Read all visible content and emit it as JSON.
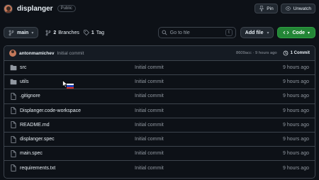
{
  "repo": {
    "name": "displanger",
    "visibility": "Public",
    "pin_label": "Pin",
    "unwatch_label": "Unwatch",
    "unwatch_count": "1"
  },
  "toolbar": {
    "branch": "main",
    "branches_count": "2",
    "branches_label": "Branches",
    "tags_count": "1",
    "tags_label": "Tag",
    "search_placeholder": "Go to file",
    "search_shortcut": "t",
    "add_file_label": "Add file",
    "code_label": "Code"
  },
  "latest_commit": {
    "author": "antonmamichev",
    "message": "Initial commit",
    "hash_time": "8609acc · 9 hours ago",
    "commits_label": "1 Commit"
  },
  "files": [
    {
      "name": "src",
      "type": "folder",
      "commit": "Initial commit",
      "date": "9 hours ago"
    },
    {
      "name": "utils",
      "type": "folder",
      "commit": "Initial commit",
      "date": "9 hours ago"
    },
    {
      "name": ".gitignore",
      "type": "file",
      "commit": "Initial commit",
      "date": "9 hours ago"
    },
    {
      "name": "Displanger.code-workspace",
      "type": "file",
      "commit": "Initial commit",
      "date": "9 hours ago"
    },
    {
      "name": "README.md",
      "type": "file",
      "commit": "Initial commit",
      "date": "9 hours ago"
    },
    {
      "name": "displanger.spec",
      "type": "file",
      "commit": "Initial commit",
      "date": "9 hours ago"
    },
    {
      "name": "main.spec",
      "type": "file",
      "commit": "Initial commit",
      "date": "9 hours ago"
    },
    {
      "name": "requirements.txt",
      "type": "file",
      "commit": "Initial commit",
      "date": "9 hours ago"
    }
  ],
  "colors": {
    "background": "#0d1117",
    "border": "#3d444d",
    "folder_icon": "#9198a1",
    "code_button": "#238636",
    "muted_text": "#9198a1"
  }
}
